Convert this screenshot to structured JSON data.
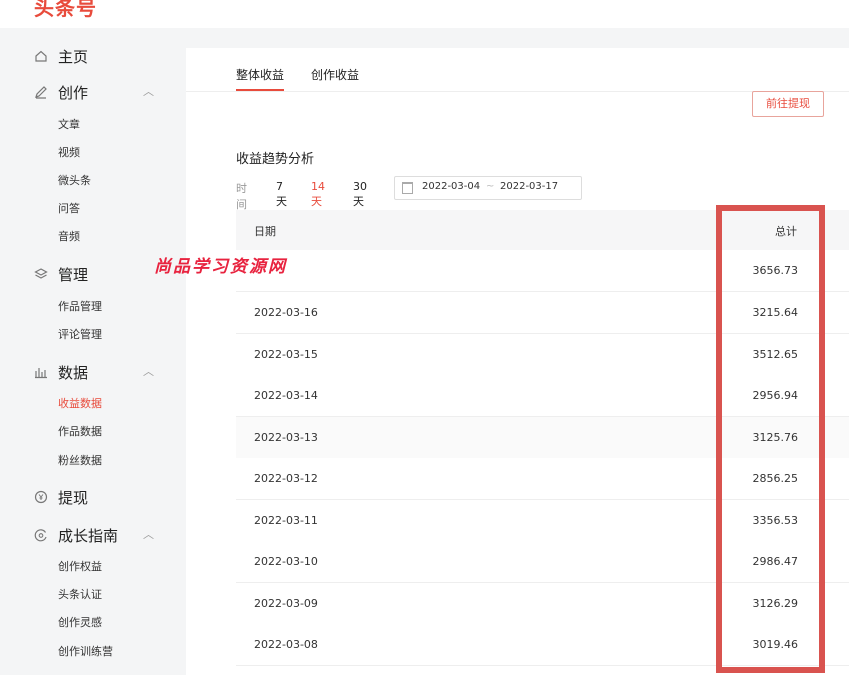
{
  "brand": {
    "logo_text": "头条号"
  },
  "sidebar": {
    "groups": [
      {
        "icon": "home-icon",
        "label": "主页",
        "expandable": false,
        "items": []
      },
      {
        "icon": "pen-icon",
        "label": "创作",
        "expandable": true,
        "items": [
          "文章",
          "视频",
          "微头条",
          "问答",
          "音频"
        ]
      },
      {
        "icon": "layers-icon",
        "label": "管理",
        "expandable": true,
        "items": [
          "作品管理",
          "评论管理"
        ]
      },
      {
        "icon": "bar-chart-icon",
        "label": "数据",
        "expandable": true,
        "items": [
          "收益数据",
          "作品数据",
          "粉丝数据"
        ],
        "active_item": "收益数据"
      },
      {
        "icon": "yen-coin-icon",
        "label": "提现",
        "expandable": false,
        "items": []
      },
      {
        "icon": "compass-icon",
        "label": "成长指南",
        "expandable": true,
        "items": [
          "创作权益",
          "头条认证",
          "创作灵感",
          "创作训练营"
        ]
      }
    ]
  },
  "main": {
    "tabs": [
      {
        "label": "整体收益",
        "active": true
      },
      {
        "label": "创作收益",
        "active": false
      }
    ],
    "withdraw_button": "前往提现",
    "section_title": "收益趋势分析",
    "filter": {
      "label": "时间",
      "options": [
        {
          "label": "7天",
          "active": false
        },
        {
          "label": "14天",
          "active": true
        },
        {
          "label": "30天",
          "active": false
        }
      ],
      "date_start": "2022-03-04",
      "date_sep": "~",
      "date_end": "2022-03-17"
    },
    "table": {
      "columns": [
        "日期",
        "总计"
      ],
      "rows": [
        {
          "date": "",
          "total": "3656.73"
        },
        {
          "date": "2022-03-16",
          "total": "3215.64"
        },
        {
          "date": "2022-03-15",
          "total": "3512.65"
        },
        {
          "date": "2022-03-14",
          "total": "2956.94"
        },
        {
          "date": "2022-03-13",
          "total": "3125.76"
        },
        {
          "date": "2022-03-12",
          "total": "2856.25"
        },
        {
          "date": "2022-03-11",
          "total": "3356.53"
        },
        {
          "date": "2022-03-10",
          "total": "2986.47"
        },
        {
          "date": "2022-03-09",
          "total": "3126.29"
        },
        {
          "date": "2022-03-08",
          "total": "3019.46"
        }
      ]
    }
  },
  "watermark": {
    "text": "尚品学习资源网"
  },
  "colors": {
    "accent": "#e84b3c",
    "highlight": "#d9534f",
    "watermark": "#e8233f"
  }
}
